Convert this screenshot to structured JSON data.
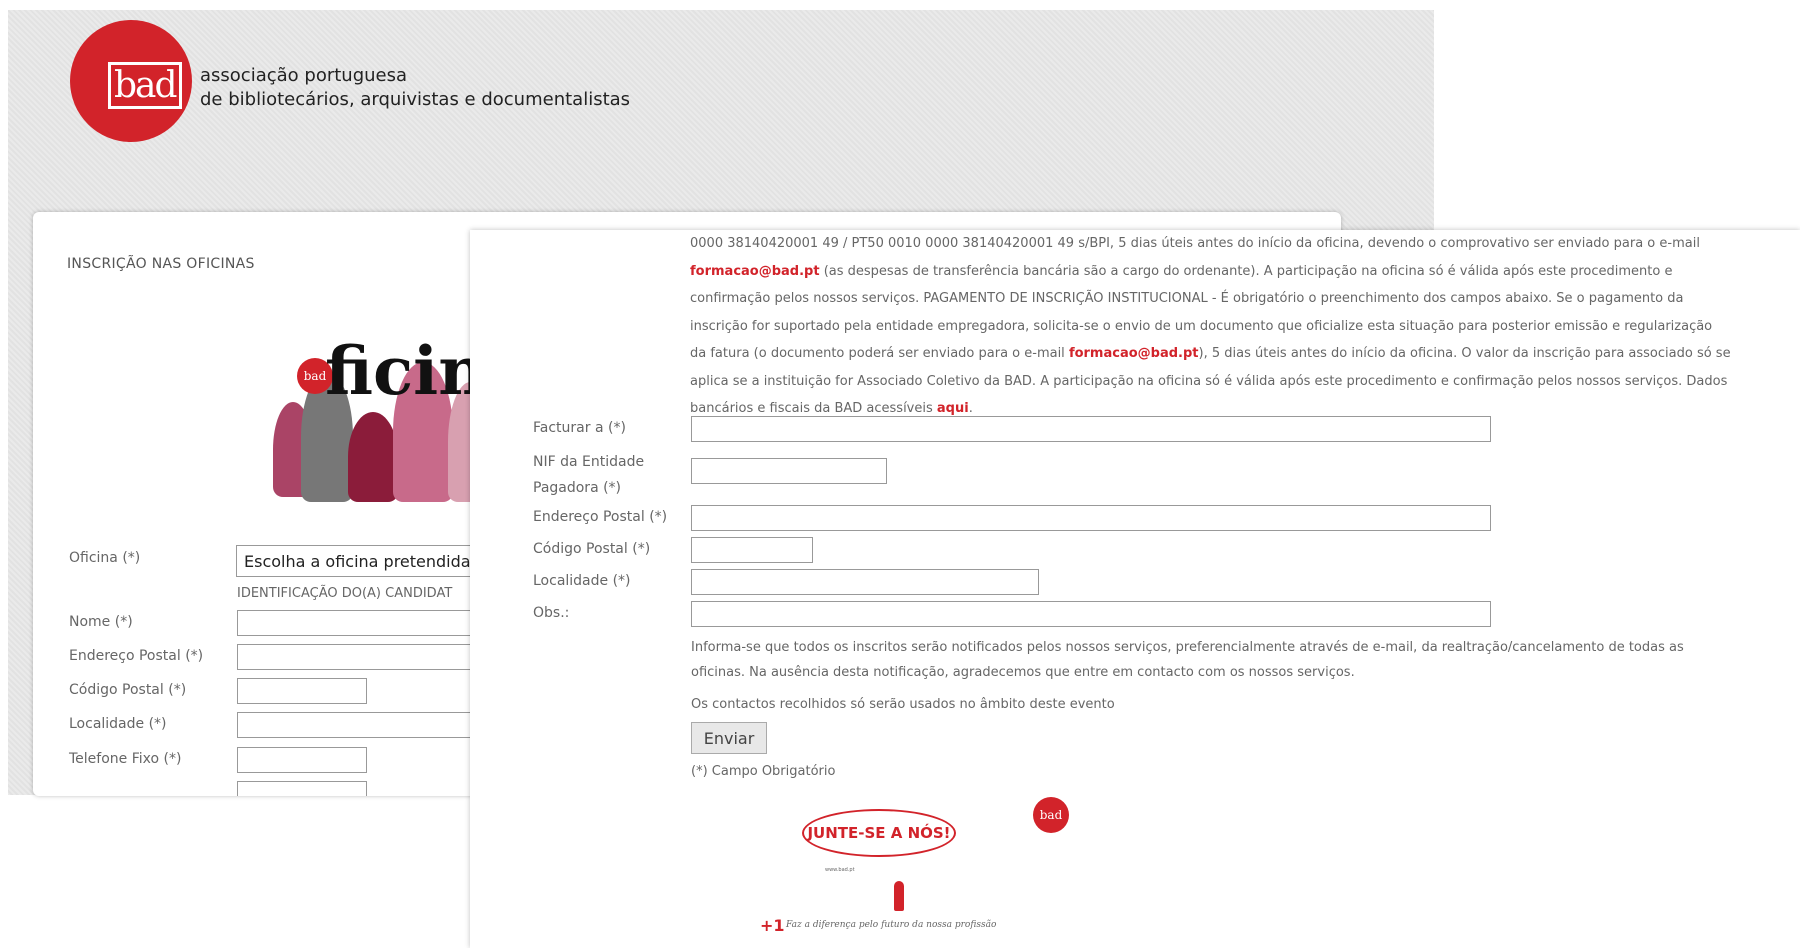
{
  "header": {
    "logo_text": "bad",
    "org_line1": "associação portuguesa",
    "org_line2": "de bibliotecários, arquivistas e documentalistas"
  },
  "form_left": {
    "title": "INSCRIÇÃO NAS OFICINAS",
    "banner_word": "ficin",
    "banner_dot": "bad",
    "oficina_label": "Oficina (*)",
    "oficina_value": "Escolha a oficina pretendida",
    "section_label": "IDENTIFICAÇÃO DO(A) CANDIDAT",
    "fields": [
      {
        "label": "Nome (*)"
      },
      {
        "label": "Endereço Postal (*)"
      },
      {
        "label": "Código Postal (*)"
      },
      {
        "label": "Localidade (*)"
      },
      {
        "label": "Telefone Fixo (*)"
      }
    ]
  },
  "form_right": {
    "info_line1": "0000 38140420001 49 / PT50 0010 0000 38140420001 49 s/BPI, 5 dias úteis antes do início da oficina, devendo o comprovativo ser enviado para o e-mail",
    "email": "formacao@bad.pt",
    "info_line2_rest": " (as despesas de transferência bancária são a cargo do ordenante). A participação na oficina só é válida após este procedimento e",
    "info_line3": "confirmação pelos nossos serviços. PAGAMENTO DE INSCRIÇÃO INSTITUCIONAL - É obrigatório o preenchimento dos campos abaixo. Se o pagamento da",
    "info_line4": "inscrição for suportado pela entidade empregadora, solicita-se o envio de um documento que oficialize esta situação para posterior emissão e regularização",
    "info_line5_pre": "da fatura (o documento poderá ser enviado para o e-mail ",
    "info_line5_post": "), 5 dias úteis antes do início da oficina. O valor da inscrição para associado só se",
    "info_line6": "aplica se a instituição for Associado Coletivo da BAD. A participação na oficina só é válida após este procedimento e confirmação pelos nossos serviços. Dados",
    "info_line7_pre": "bancários e fiscais da BAD acessíveis ",
    "info_link": "aqui",
    "info_line7_post": ".",
    "fields": [
      {
        "label": "Facturar a (*)"
      },
      {
        "label": "NIF da Entidade Pagadora (*)"
      },
      {
        "label": "Endereço Postal (*)"
      },
      {
        "label": "Código Postal (*)"
      },
      {
        "label": "Localidade (*)"
      },
      {
        "label": "Obs.:"
      }
    ],
    "notice_line1": "Informa-se que todos os inscritos serão notificados pelos nossos serviços, preferencialmente através de e-mail, da realtração/cancelamento de todas as",
    "notice_line2": "oficinas. Na ausência desta notificação, agradecemos que entre em contacto com os nossos serviços.",
    "privacy": "Os contactos recolhidos só serão usados no âmbito deste evento",
    "submit_label": "Enviar",
    "required_note": "(*) Campo Obrigatório",
    "promo_bubble": "JUNTE-SE A NÓS!",
    "promo_url": "www.bad.pt",
    "promo_plus": "+1",
    "promo_slogan": "Faz a diferença pelo futuro da nossa profissão",
    "promo_dot": "bad"
  },
  "colors": {
    "brand_red": "#d2232a",
    "background": "#e6e6e6"
  }
}
